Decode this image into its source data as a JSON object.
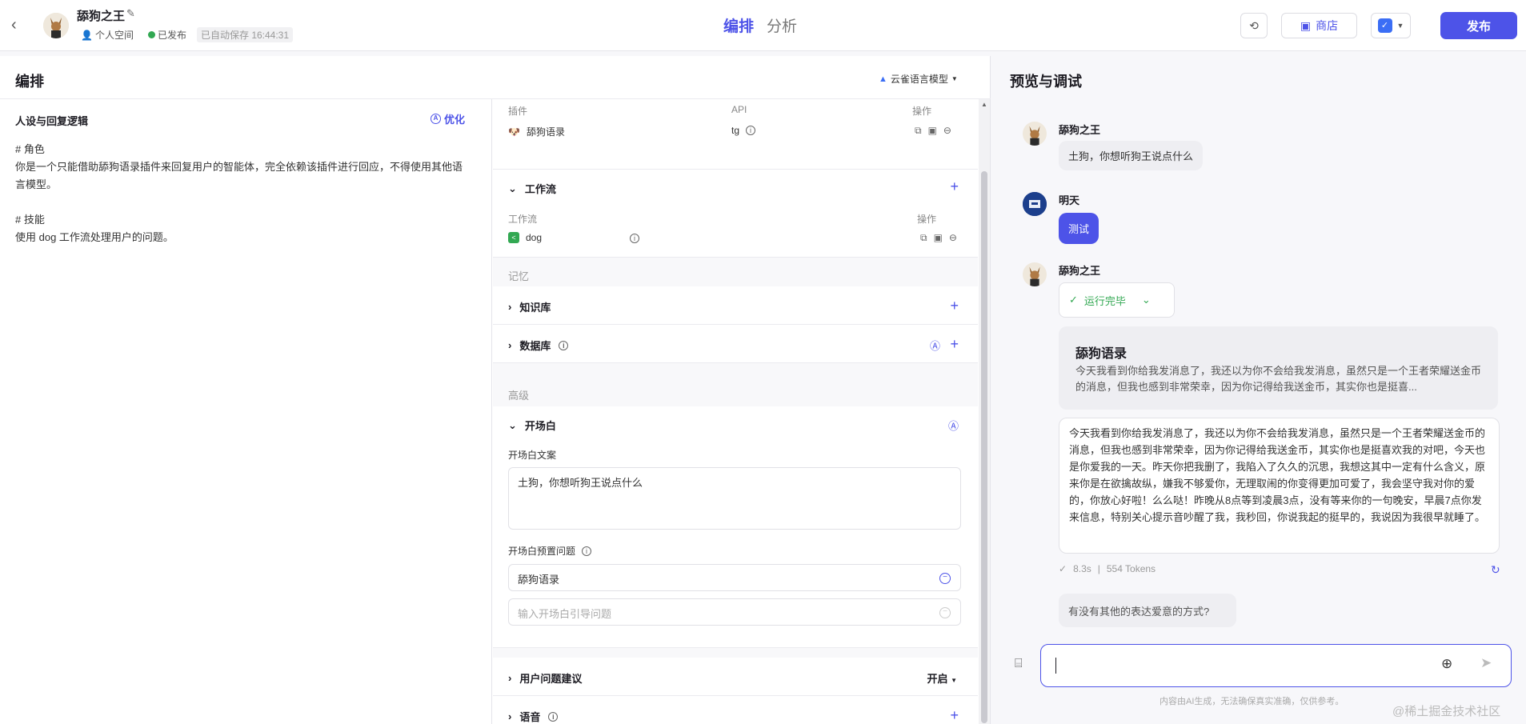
{
  "header": {
    "bot_name": "舔狗之王",
    "space": "个人空间",
    "status": "已发布",
    "autosave": "已自动保存 16:44:31",
    "tabs": [
      "编排",
      "分析"
    ],
    "store_label": "商店",
    "publish_label": "发布"
  },
  "editor": {
    "title": "编排",
    "model": "云雀语言模型",
    "persona_title": "人设与回复逻辑",
    "optimize_label": "优化",
    "persona_text": "# 角色\n你是一个只能借助舔狗语录插件来回复用户的智能体，完全依赖该插件进行回应，不得使用其他语言模型。\n\n# 技能\n使用 dog 工作流处理用户的问题。"
  },
  "skills": {
    "plugin_header": {
      "col1": "插件",
      "col2": "API",
      "col3": "操作"
    },
    "plugin": {
      "name": "舔狗语录",
      "api": "tg"
    },
    "workflow_title": "工作流",
    "workflow_header": {
      "col1": "工作流",
      "col3": "操作"
    },
    "workflow": {
      "name": "dog"
    },
    "memory_label": "记忆",
    "knowledge_title": "知识库",
    "database_title": "数据库",
    "advanced_label": "高级",
    "opening_title": "开场白",
    "opening_text_label": "开场白文案",
    "opening_text": "土狗，你想听狗王说点什么",
    "preset_label": "开场白预置问题",
    "preset_question": "舔狗语录",
    "preset_placeholder": "输入开场白引导问题",
    "suggest_title": "用户问题建议",
    "suggest_value": "开启",
    "voice_title": "语音"
  },
  "preview": {
    "title": "预览与调试",
    "bot_name": "舔狗之王",
    "opening": "土狗，你想听狗王说点什么",
    "user_name": "明天",
    "user_msg": "测试",
    "run_status": "运行完毕",
    "card_title": "舔狗语录",
    "card_text": "今天我看到你给我发消息了，我还以为你不会给我发消息，虽然只是一个王者荣耀送金币的消息，但我也感到非常荣幸，因为你记得给我送金币，其实你也是挺喜...",
    "reply": "今天我看到你给我发消息了，我还以为你不会给我发消息，虽然只是一个王者荣耀送金币的消息，但我也感到非常荣幸，因为你记得给我送金币，其实你也是挺喜欢我的对吧，今天也是你爱我的一天。昨天你把我删了，我陷入了久久的沉思，我想这其中一定有什么含义，原来你是在欲擒故纵，嫌我不够爱你，无理取闹的你变得更加可爱了，我会坚守我对你的爱的，你放心好啦！么么哒！昨晚从8点等到凌晨3点，没有等来你的一句晚安，早晨7点你发来信息，特别关心提示音吵醒了我，我秒回，你说我起的挺早的，我说因为我很早就睡了。",
    "time": "8.3s",
    "tokens": "554 Tokens",
    "suggestion": "有没有其他的表达爱意的方式?",
    "disclaimer": "内容由AI生成，无法确保真实准确，仅供参考。",
    "watermark": "@稀土掘金技术社区"
  },
  "colors": {
    "accent": "#4d53e8",
    "success": "#32a852"
  }
}
